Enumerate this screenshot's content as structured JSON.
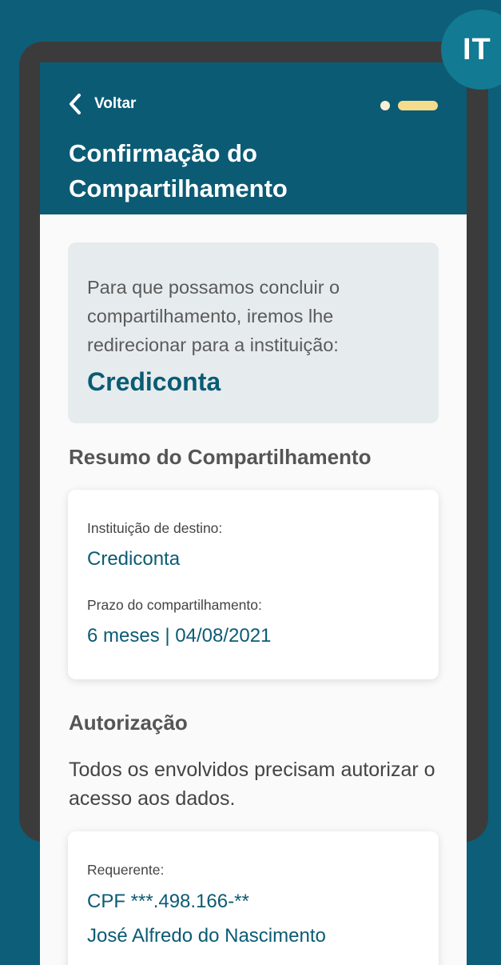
{
  "colors": {
    "background": "#0d5e78",
    "header": "#0b5b74",
    "accent": "#0b5b74",
    "badge": "#127a92",
    "progress_active": "#f4dc8c"
  },
  "badge": {
    "label": "IT"
  },
  "header": {
    "back_label": "Voltar",
    "back_icon": "chevron-left-icon",
    "title": "Confirmação do Compartilhamento",
    "progress": {
      "steps": 2,
      "current": 2
    }
  },
  "redirect_info": {
    "text": "Para que possamos concluir o compartilhamento, iremos lhe redirecionar para a instituição:",
    "institution": "Crediconta"
  },
  "summary": {
    "title": "Resumo do Compartilhamento",
    "destination_label": "Instituição de destino:",
    "destination_value": "Crediconta",
    "term_label": "Prazo do compartilhamento:",
    "term_value": "6 meses | 04/08/2021"
  },
  "authorization": {
    "title": "Autorização",
    "text": "Todos os envolvidos precisam autorizar o acesso aos dados.",
    "requester_label": "Requerente:",
    "requester_cpf": "CPF ***.498.166-**",
    "requester_name": "José Alfredo do Nascimento"
  }
}
